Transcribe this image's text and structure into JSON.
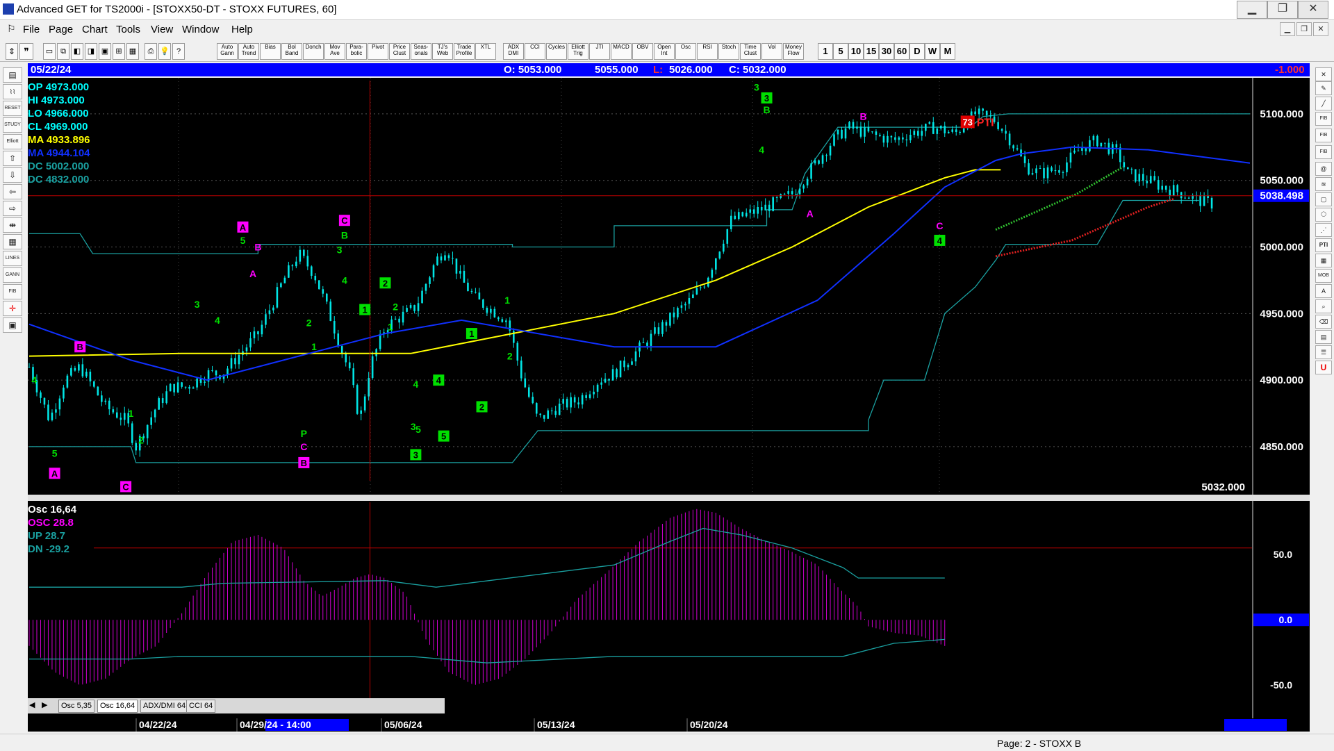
{
  "window": {
    "title": "Advanced GET for TS2000i - [STOXX50-DT - STOXX FUTURES, 60]",
    "min": "▁",
    "max": "❐",
    "close": "✕"
  },
  "menu": [
    "File",
    "Page",
    "Chart",
    "Tools",
    "View",
    "Window",
    "Help"
  ],
  "toolbar": {
    "studies": [
      "Auto Gann",
      "Auto Trend",
      "Bias",
      "Bol Band",
      "Donch",
      "Mov Ave",
      "Para-bolic",
      "Pivot",
      "Price Clust",
      "Seas-onals",
      "TJ's Web",
      "Trade Profile",
      "XTL",
      "ADX DMI",
      "CCI",
      "Cycles",
      "Elliott Trig",
      "JTI",
      "MACD",
      "OBV",
      "Open Int",
      "Osc",
      "RSI",
      "Stoch",
      "Time Clust",
      "Vol",
      "Money Flow"
    ],
    "periods": [
      "1",
      "5",
      "10",
      "15",
      "30",
      "60",
      "D",
      "W",
      "M"
    ]
  },
  "infobar": {
    "date": "05/22/24",
    "open": "O: 5053.000",
    "high": "5055.000",
    "low_label": "L:",
    "low": "5026.000",
    "close": "C: 5032.000",
    "change": "-1.000"
  },
  "legend": [
    {
      "label": "OP",
      "value": "4973.000",
      "color": "#00ffff"
    },
    {
      "label": "HI",
      "value": "4973.000",
      "color": "#00ffff"
    },
    {
      "label": "LO",
      "value": "4966.000",
      "color": "#00ffff"
    },
    {
      "label": "CL",
      "value": "4969.000",
      "color": "#00ffff"
    },
    {
      "label": "MA",
      "value": "4933.896",
      "color": "#ffff00"
    },
    {
      "label": "MA",
      "value": "4944.104",
      "color": "#1030ff"
    },
    {
      "label": "DC",
      "value": "5002.000",
      "color": "#1aa0a0"
    },
    {
      "label": "DC",
      "value": "4832.000",
      "color": "#1aa0a0"
    }
  ],
  "osc_legend": [
    {
      "label": "Osc 16,64",
      "value": "",
      "color": "#ffffff"
    },
    {
      "label": "OSC",
      "value": "28.8",
      "color": "#ff00ff"
    },
    {
      "label": "UP",
      "value": "28.7",
      "color": "#1aa0a0"
    },
    {
      "label": "DN",
      "value": "-29.2",
      "color": "#1aa0a0"
    }
  ],
  "tabs": [
    "Osc 5,35",
    "Osc 16,64",
    "ADX/DMI 64",
    "CCI 64"
  ],
  "status": "Page: 2 - STOXX B",
  "chart_data": [
    {
      "type": "candlestick",
      "title": "STOXX50-DT - STOXX FUTURES, 60",
      "ylim": [
        4815,
        5125
      ],
      "yticks": [
        5100,
        5050,
        5000,
        4950,
        4900,
        4850
      ],
      "ytick_labels": [
        "5100.000",
        "5050.000",
        "5000.000",
        "4950.000",
        "4900.000",
        "4850.000"
      ],
      "last_price": "5038.498",
      "last_close_label": "5032.000",
      "x_labels": [
        "04/22/24",
        "04/29/24 - 14:00",
        "05/06/24",
        "05/13/24",
        "05/20/24"
      ],
      "n_bars": 310,
      "price_path": [
        [
          0,
          4910
        ],
        [
          8,
          4870
        ],
        [
          14,
          4900
        ],
        [
          20,
          4910
        ],
        [
          30,
          4880
        ],
        [
          38,
          4870
        ],
        [
          42,
          4850
        ],
        [
          50,
          4880
        ],
        [
          56,
          4895
        ],
        [
          62,
          4895
        ],
        [
          70,
          4905
        ],
        [
          76,
          4905
        ],
        [
          90,
          4935
        ],
        [
          100,
          4975
        ],
        [
          106,
          4995
        ],
        [
          112,
          4980
        ],
        [
          118,
          4950
        ],
        [
          126,
          4905
        ],
        [
          130,
          4870
        ],
        [
          134,
          4910
        ],
        [
          140,
          4940
        ],
        [
          152,
          4955
        ],
        [
          160,
          4990
        ],
        [
          164,
          5000
        ],
        [
          170,
          4975
        ],
        [
          176,
          4960
        ],
        [
          188,
          4945
        ],
        [
          194,
          4900
        ],
        [
          200,
          4870
        ],
        [
          208,
          4880
        ],
        [
          216,
          4885
        ],
        [
          224,
          4900
        ],
        [
          230,
          4905
        ],
        [
          238,
          4920
        ],
        [
          246,
          4935
        ],
        [
          254,
          4950
        ],
        [
          260,
          4960
        ],
        [
          266,
          4975
        ],
        [
          276,
          5020
        ],
        [
          290,
          5030
        ],
        [
          300,
          5040
        ],
        [
          306,
          5055
        ],
        [
          316,
          5080
        ],
        [
          322,
          5090
        ],
        [
          330,
          5085
        ],
        [
          340,
          5080
        ],
        [
          346,
          5085
        ],
        [
          356,
          5090
        ],
        [
          364,
          5085
        ],
        [
          372,
          5100
        ],
        [
          380,
          5095
        ],
        [
          386,
          5080
        ],
        [
          392,
          5060
        ],
        [
          398,
          5055
        ],
        [
          406,
          5060
        ],
        [
          414,
          5075
        ],
        [
          420,
          5080
        ],
        [
          428,
          5070
        ],
        [
          432,
          5055
        ],
        [
          440,
          5050
        ],
        [
          446,
          5045
        ],
        [
          454,
          5040
        ],
        [
          460,
          5035
        ],
        [
          466,
          5032
        ]
      ],
      "ma_yellow": [
        [
          0,
          4918
        ],
        [
          60,
          4920
        ],
        [
          100,
          4920
        ],
        [
          150,
          4920
        ],
        [
          190,
          4935
        ],
        [
          230,
          4950
        ],
        [
          270,
          4975
        ],
        [
          300,
          5000
        ],
        [
          330,
          5030
        ],
        [
          360,
          5052
        ],
        [
          372,
          5058
        ],
        [
          382,
          5058
        ]
      ],
      "ma_blue": [
        [
          0,
          4942
        ],
        [
          40,
          4915
        ],
        [
          70,
          4900
        ],
        [
          100,
          4915
        ],
        [
          140,
          4935
        ],
        [
          170,
          4945
        ],
        [
          200,
          4935
        ],
        [
          230,
          4925
        ],
        [
          270,
          4925
        ],
        [
          310,
          4960
        ],
        [
          340,
          5010
        ],
        [
          360,
          5045
        ],
        [
          380,
          5065
        ],
        [
          390,
          5070
        ],
        [
          410,
          5075
        ],
        [
          440,
          5073
        ],
        [
          460,
          5068
        ],
        [
          480,
          5063
        ]
      ],
      "dc_upper": [
        [
          0,
          5010
        ],
        [
          20,
          5010
        ],
        [
          25,
          4995
        ],
        [
          90,
          4995
        ],
        [
          90,
          5002
        ],
        [
          190,
          5002
        ],
        [
          190,
          5000
        ],
        [
          230,
          5000
        ],
        [
          230,
          5016
        ],
        [
          290,
          5016
        ],
        [
          290,
          5028
        ],
        [
          300,
          5028
        ],
        [
          305,
          5055
        ],
        [
          318,
          5090
        ],
        [
          370,
          5090
        ],
        [
          375,
          5098
        ],
        [
          385,
          5100
        ],
        [
          480,
          5100
        ]
      ],
      "dc_lower": [
        [
          0,
          4850
        ],
        [
          40,
          4850
        ],
        [
          42,
          4838
        ],
        [
          190,
          4838
        ],
        [
          200,
          4862
        ],
        [
          300,
          4862
        ],
        [
          330,
          4862
        ],
        [
          330,
          4870
        ],
        [
          336,
          4900
        ],
        [
          352,
          4900
        ],
        [
          360,
          4950
        ],
        [
          372,
          4970
        ],
        [
          380,
          4990
        ],
        [
          384,
          5002
        ],
        [
          420,
          5002
        ],
        [
          430,
          5035
        ],
        [
          460,
          5035
        ]
      ],
      "tline_green": [
        [
          380,
          5013
        ],
        [
          412,
          5040
        ],
        [
          430,
          5060
        ]
      ],
      "tline_red": [
        [
          380,
          4993
        ],
        [
          410,
          5005
        ],
        [
          440,
          5030
        ],
        [
          450,
          5036
        ]
      ],
      "hline_red": 5038.5,
      "cursor_bar": 134,
      "annotations": [
        {
          "bar": 2,
          "price": 4900,
          "text": "4",
          "kind": "txt"
        },
        {
          "bar": 10,
          "price": 4845,
          "text": "5",
          "kind": "txt"
        },
        {
          "bar": 10,
          "price": 4830,
          "text": "A",
          "kind": "box-m"
        },
        {
          "bar": 20,
          "price": 4925,
          "text": "B",
          "kind": "box-m"
        },
        {
          "bar": 40,
          "price": 4875,
          "text": "1",
          "kind": "txt"
        },
        {
          "bar": 44,
          "price": 4855,
          "text": "2",
          "kind": "txt"
        },
        {
          "bar": 38,
          "price": 4820,
          "text": "C",
          "kind": "box-m"
        },
        {
          "bar": 66,
          "price": 4957,
          "text": "3",
          "kind": "txt"
        },
        {
          "bar": 74,
          "price": 4945,
          "text": "4",
          "kind": "txt"
        },
        {
          "bar": 84,
          "price": 5015,
          "text": "A",
          "kind": "box-m"
        },
        {
          "bar": 84,
          "price": 5005,
          "text": "5",
          "kind": "txt"
        },
        {
          "bar": 90,
          "price": 5000,
          "text": "B",
          "kind": "txt-m"
        },
        {
          "bar": 88,
          "price": 4980,
          "text": "A",
          "kind": "txt-m"
        },
        {
          "bar": 112,
          "price": 4925,
          "text": "1",
          "kind": "txt"
        },
        {
          "bar": 110,
          "price": 4943,
          "text": "2",
          "kind": "txt"
        },
        {
          "bar": 108,
          "price": 4860,
          "text": "P",
          "kind": "txt"
        },
        {
          "bar": 108,
          "price": 4850,
          "text": "C",
          "kind": "txt-m"
        },
        {
          "bar": 108,
          "price": 4838,
          "text": "B",
          "kind": "box-m"
        },
        {
          "bar": 122,
          "price": 4998,
          "text": "3",
          "kind": "txt"
        },
        {
          "bar": 124,
          "price": 4975,
          "text": "4",
          "kind": "txt"
        },
        {
          "bar": 124,
          "price": 5020,
          "text": "C",
          "kind": "box-m"
        },
        {
          "bar": 124,
          "price": 5009,
          "text": "B",
          "kind": "txt-g"
        },
        {
          "bar": 132,
          "price": 4953,
          "text": "1",
          "kind": "box-g"
        },
        {
          "bar": 140,
          "price": 4973,
          "text": "2",
          "kind": "box-g"
        },
        {
          "bar": 144,
          "price": 4955,
          "text": "2",
          "kind": "txt"
        },
        {
          "bar": 142,
          "price": 4940,
          "text": "1",
          "kind": "txt"
        },
        {
          "bar": 152,
          "price": 4897,
          "text": "4",
          "kind": "txt"
        },
        {
          "bar": 151,
          "price": 4865,
          "text": "3",
          "kind": "txt"
        },
        {
          "bar": 153,
          "price": 4863,
          "text": "5",
          "kind": "txt"
        },
        {
          "bar": 152,
          "price": 4844,
          "text": "3",
          "kind": "box-g"
        },
        {
          "bar": 161,
          "price": 4900,
          "text": "4",
          "kind": "box-g"
        },
        {
          "bar": 163,
          "price": 4858,
          "text": "5",
          "kind": "box-g"
        },
        {
          "bar": 174,
          "price": 4935,
          "text": "1",
          "kind": "box-g"
        },
        {
          "bar": 178,
          "price": 4880,
          "text": "2",
          "kind": "box-g"
        },
        {
          "bar": 188,
          "price": 4960,
          "text": "1",
          "kind": "txt"
        },
        {
          "bar": 189,
          "price": 4918,
          "text": "2",
          "kind": "txt"
        },
        {
          "bar": 286,
          "price": 5120,
          "text": "3",
          "kind": "txt"
        },
        {
          "bar": 290,
          "price": 5112,
          "text": "3",
          "kind": "box-g"
        },
        {
          "bar": 290,
          "price": 5103,
          "text": "B",
          "kind": "txt-g"
        },
        {
          "bar": 288,
          "price": 5073,
          "text": "4",
          "kind": "txt"
        },
        {
          "bar": 307,
          "price": 5025,
          "text": "A",
          "kind": "txt-m"
        },
        {
          "bar": 328,
          "price": 5098,
          "text": "B",
          "kind": "txt-m"
        },
        {
          "bar": 358,
          "price": 5016,
          "text": "C",
          "kind": "txt-m"
        },
        {
          "bar": 358,
          "price": 5005,
          "text": "4",
          "kind": "box-g"
        }
      ],
      "pti": {
        "value": "73",
        "label": "PTI"
      }
    },
    {
      "type": "bar",
      "title": "Osc 16,64",
      "ylim": [
        -60,
        90
      ],
      "yticks": [
        50,
        0,
        -50
      ],
      "ytick_labels": [
        "50.0",
        "0.0",
        "-50.0"
      ],
      "osc_path": [
        [
          0,
          -20
        ],
        [
          10,
          -40
        ],
        [
          20,
          -50
        ],
        [
          30,
          -45
        ],
        [
          40,
          -30
        ],
        [
          50,
          -20
        ],
        [
          60,
          5
        ],
        [
          70,
          35
        ],
        [
          80,
          60
        ],
        [
          90,
          65
        ],
        [
          100,
          55
        ],
        [
          108,
          30
        ],
        [
          115,
          18
        ],
        [
          122,
          25
        ],
        [
          128,
          32
        ],
        [
          134,
          35
        ],
        [
          140,
          32
        ],
        [
          148,
          20
        ],
        [
          156,
          -15
        ],
        [
          165,
          -40
        ],
        [
          175,
          -50
        ],
        [
          185,
          -45
        ],
        [
          195,
          -30
        ],
        [
          205,
          -10
        ],
        [
          215,
          15
        ],
        [
          228,
          38
        ],
        [
          240,
          60
        ],
        [
          252,
          78
        ],
        [
          262,
          85
        ],
        [
          270,
          82
        ],
        [
          280,
          70
        ],
        [
          290,
          60
        ],
        [
          300,
          52
        ],
        [
          310,
          42
        ],
        [
          318,
          25
        ],
        [
          326,
          10
        ],
        [
          330,
          -5
        ],
        [
          340,
          -10
        ],
        [
          350,
          -12
        ],
        [
          360,
          -20
        ]
      ],
      "up_line": [
        [
          0,
          25
        ],
        [
          60,
          25
        ],
        [
          76,
          28
        ],
        [
          140,
          30
        ],
        [
          160,
          25
        ],
        [
          230,
          42
        ],
        [
          252,
          60
        ],
        [
          265,
          70
        ],
        [
          280,
          65
        ],
        [
          300,
          55
        ],
        [
          320,
          40
        ],
        [
          326,
          32
        ],
        [
          360,
          32
        ]
      ],
      "dn_line": [
        [
          0,
          -30
        ],
        [
          40,
          -30
        ],
        [
          60,
          -28
        ],
        [
          150,
          -28
        ],
        [
          180,
          -33
        ],
        [
          230,
          -28
        ],
        [
          320,
          -28
        ],
        [
          340,
          -18
        ],
        [
          360,
          -15
        ]
      ],
      "red_level": 55
    }
  ]
}
